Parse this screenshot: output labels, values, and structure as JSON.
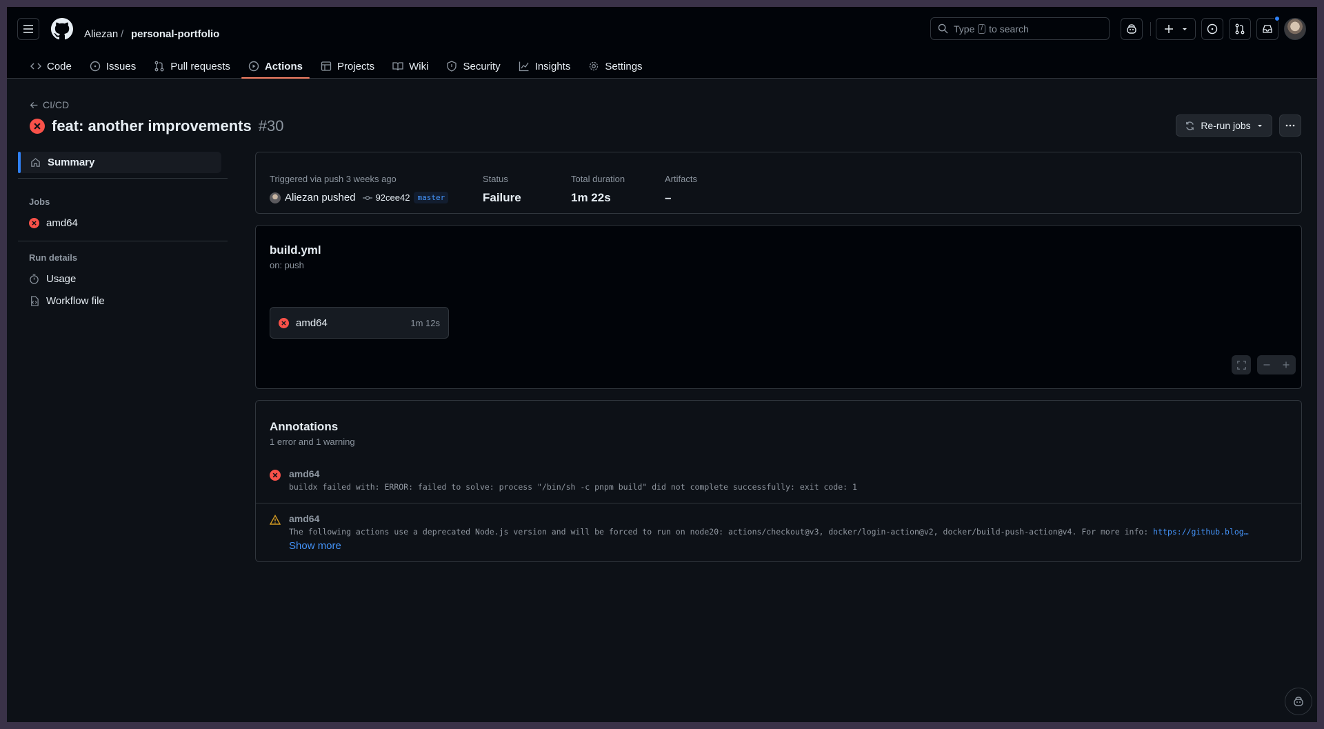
{
  "header": {
    "owner": "Aliezan",
    "separator": "/",
    "repo": "personal-portfolio",
    "search_prefix": "Type",
    "search_key": "/",
    "search_suffix": "to search"
  },
  "tabs": [
    {
      "label": "Code",
      "icon": "code-icon"
    },
    {
      "label": "Issues",
      "icon": "issue-icon"
    },
    {
      "label": "Pull requests",
      "icon": "pull-request-icon"
    },
    {
      "label": "Actions",
      "icon": "play-icon",
      "active": true
    },
    {
      "label": "Projects",
      "icon": "table-icon"
    },
    {
      "label": "Wiki",
      "icon": "book-icon"
    },
    {
      "label": "Security",
      "icon": "shield-icon"
    },
    {
      "label": "Insights",
      "icon": "graph-icon"
    },
    {
      "label": "Settings",
      "icon": "gear-icon"
    }
  ],
  "run": {
    "back_label": "CI/CD",
    "title": "feat: another improvements",
    "number": "#30",
    "rerun_label": "Re-run jobs"
  },
  "sidebar": {
    "summary_label": "Summary",
    "jobs_heading": "Jobs",
    "job_label": "amd64",
    "run_details_heading": "Run details",
    "usage_label": "Usage",
    "workflow_file_label": "Workflow file"
  },
  "summary": {
    "triggered_label": "Triggered via push 3 weeks ago",
    "actor": "Aliezan pushed",
    "sha": "92cee42",
    "branch": "master",
    "status_label": "Status",
    "status_value": "Failure",
    "duration_label": "Total duration",
    "duration_value": "1m 22s",
    "artifacts_label": "Artifacts",
    "artifacts_value": "–"
  },
  "workflow": {
    "file": "build.yml",
    "trigger": "on: push",
    "job_name": "amd64",
    "job_duration": "1m 12s"
  },
  "annotations": {
    "title": "Annotations",
    "subtitle": "1 error and 1 warning",
    "items": [
      {
        "name": "amd64",
        "severity": "error",
        "message": "buildx failed with: ERROR: failed to solve: process \"/bin/sh -c pnpm build\" did not complete successfully: exit code: 1"
      },
      {
        "name": "amd64",
        "severity": "warning",
        "message": "The following actions use a deprecated Node.js version and will be forced to run on node20: actions/checkout@v3, docker/login-action@v2, docker/build-push-action@v4. For more info: ",
        "link": "https://github.blog…"
      }
    ],
    "show_more": "Show more"
  },
  "colors": {
    "accent": "#2f81f7",
    "error": "#f85149",
    "warning": "#d29922",
    "tab_underline": "#f78166"
  }
}
